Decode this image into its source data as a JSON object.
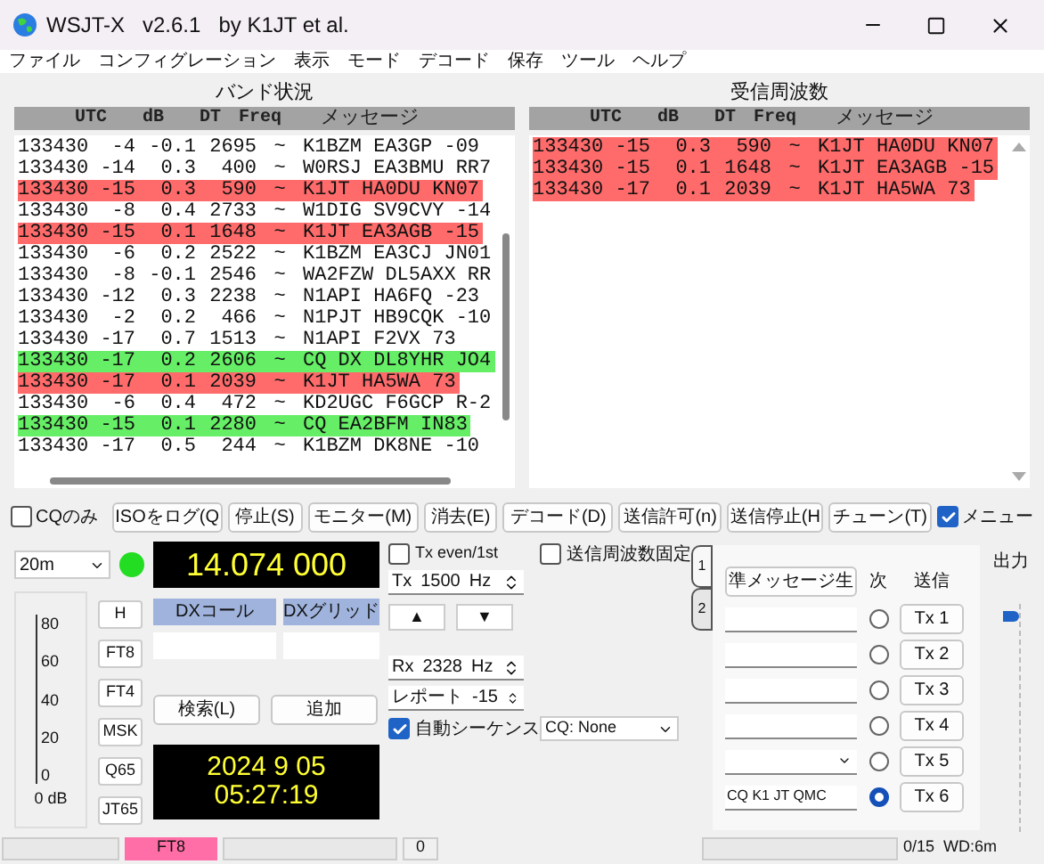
{
  "window": {
    "title": "WSJT-X   v2.6.1   by K1JT et al."
  },
  "menu": [
    "ファイル",
    "コンフィグレーション",
    "表示",
    "モード",
    "デコード",
    "保存",
    "ツール",
    "ヘルプ"
  ],
  "band_activity": {
    "title": "バンド状況",
    "columns": [
      "UTC",
      "dB",
      "DT",
      "Freq",
      "メッセージ"
    ],
    "rows": [
      {
        "utc": "133430",
        "db": "-4",
        "dt": "-0.1",
        "freq": "2695",
        "sep": "~",
        "message": "K1BZM EA3GP -09",
        "color": "#ffffff"
      },
      {
        "utc": "133430",
        "db": "-14",
        "dt": "0.3",
        "freq": "400",
        "sep": "~",
        "message": "W0RSJ EA3BMU RR7",
        "color": "#ffffff"
      },
      {
        "utc": "133430",
        "db": "-15",
        "dt": "0.3",
        "freq": "590",
        "sep": "~",
        "message": "K1JT HA0DU KN07",
        "color": "#ff6b6b"
      },
      {
        "utc": "133430",
        "db": "-8",
        "dt": "0.4",
        "freq": "2733",
        "sep": "~",
        "message": "W1DIG SV9CVY -14",
        "color": "#ffffff"
      },
      {
        "utc": "133430",
        "db": "-15",
        "dt": "0.1",
        "freq": "1648",
        "sep": "~",
        "message": "K1JT EA3AGB -15",
        "color": "#ff6b6b"
      },
      {
        "utc": "133430",
        "db": "-6",
        "dt": "0.2",
        "freq": "2522",
        "sep": "~",
        "message": "K1BZM EA3CJ JN01",
        "color": "#ffffff"
      },
      {
        "utc": "133430",
        "db": "-8",
        "dt": "-0.1",
        "freq": "2546",
        "sep": "~",
        "message": "WA2FZW DL5AXX RR",
        "color": "#ffffff"
      },
      {
        "utc": "133430",
        "db": "-12",
        "dt": "0.3",
        "freq": "2238",
        "sep": "~",
        "message": "N1API HA6FQ -23",
        "color": "#ffffff"
      },
      {
        "utc": "133430",
        "db": "-2",
        "dt": "0.2",
        "freq": "466",
        "sep": "~",
        "message": "N1PJT HB9CQK -10",
        "color": "#ffffff"
      },
      {
        "utc": "133430",
        "db": "-17",
        "dt": "0.7",
        "freq": "1513",
        "sep": "~",
        "message": "N1API F2VX 73",
        "color": "#ffffff"
      },
      {
        "utc": "133430",
        "db": "-17",
        "dt": "0.2",
        "freq": "2606",
        "sep": "~",
        "message": "CQ DX DL8YHR JO4",
        "color": "#66ee66"
      },
      {
        "utc": "133430",
        "db": "-17",
        "dt": "0.1",
        "freq": "2039",
        "sep": "~",
        "message": "K1JT HA5WA 73",
        "color": "#ff6b6b"
      },
      {
        "utc": "133430",
        "db": "-6",
        "dt": "0.4",
        "freq": "472",
        "sep": "~",
        "message": "KD2UGC F6GCP R-2",
        "color": "#ffffff"
      },
      {
        "utc": "133430",
        "db": "-15",
        "dt": "0.1",
        "freq": "2280",
        "sep": "~",
        "message": "CQ EA2BFM IN83",
        "color": "#66ee66"
      },
      {
        "utc": "133430",
        "db": "-17",
        "dt": "0.5",
        "freq": "244",
        "sep": "~",
        "message": "K1BZM DK8NE -10",
        "color": "#ffffff"
      }
    ]
  },
  "rx_frequency": {
    "title": "受信周波数",
    "columns": [
      "UTC",
      "dB",
      "DT",
      "Freq",
      "メッセージ"
    ],
    "rows": [
      {
        "utc": "133430",
        "db": "-15",
        "dt": "0.3",
        "freq": "590",
        "sep": "~",
        "message": "K1JT HA0DU KN07",
        "color": "#ff6b6b"
      },
      {
        "utc": "133430",
        "db": "-15",
        "dt": "0.1",
        "freq": "1648",
        "sep": "~",
        "message": "K1JT EA3AGB -15",
        "color": "#ff6b6b"
      },
      {
        "utc": "133430",
        "db": "-17",
        "dt": "0.1",
        "freq": "2039",
        "sep": "~",
        "message": "K1JT HA5WA 73",
        "color": "#ff6b6b"
      }
    ]
  },
  "cq_only": {
    "label": "CQのみ",
    "checked": false
  },
  "buttons": [
    "ISOをログ(Q",
    "停止(S)",
    "モニター(M)",
    "消去(E)",
    "デコード(D)",
    "送信許可(n)",
    "送信停止(H",
    "チューン(T)"
  ],
  "menus_toggle": {
    "label": "メニュー",
    "checked": true
  },
  "band": {
    "value": "20m"
  },
  "frequency": "14.074 000",
  "meter": {
    "ticks": [
      "80",
      "60",
      "40",
      "20",
      "0"
    ],
    "reading": "0 dB"
  },
  "modes": [
    "H",
    "FT8",
    "FT4",
    "MSK",
    "Q65",
    "JT65"
  ],
  "dx_call": {
    "label": "DXコール"
  },
  "dx_grid": {
    "label": "DXグリッド"
  },
  "lookup_button": "検索(L)",
  "add_button": "追加",
  "clock": {
    "date": "2024 9 05",
    "time": "05:27:19"
  },
  "tx_even": {
    "label": "Tx even/1st",
    "checked": false
  },
  "tx_freq": {
    "prefix": "Tx",
    "value": "1500",
    "unit": "Hz"
  },
  "arrows": [
    "▲",
    "▼"
  ],
  "rx_freq": {
    "prefix": "Rx",
    "value": "2328",
    "unit": "Hz"
  },
  "report": {
    "prefix": "レポート",
    "value": "-15"
  },
  "auto_seq": {
    "label": "自動シーケンス",
    "checked": true
  },
  "hold_tx": {
    "label": "送信周波数固定",
    "checked": false
  },
  "cq_select": {
    "value": "CQ: None"
  },
  "tabs": [
    {
      "label": "1",
      "selected": true
    },
    {
      "label": "2",
      "selected": false
    }
  ],
  "messages": {
    "generate": "準メッセージ生",
    "next_header": "次",
    "send_header": "送信",
    "rows": [
      {
        "kind": "field",
        "value": "",
        "selected": false,
        "button": "Tx 1"
      },
      {
        "kind": "field",
        "value": "",
        "selected": false,
        "button": "Tx 2"
      },
      {
        "kind": "field",
        "value": "",
        "selected": false,
        "button": "Tx 3"
      },
      {
        "kind": "field",
        "value": "",
        "selected": false,
        "button": "Tx 4"
      },
      {
        "kind": "select",
        "value": "",
        "selected": false,
        "button": "Tx 5"
      },
      {
        "kind": "field",
        "value": "CQ K1 JT QMC",
        "selected": true,
        "button": "Tx 6"
      }
    ]
  },
  "power": {
    "label": "出力",
    "level": 0.97
  },
  "status_bar": {
    "mode": "FT8",
    "count": "0",
    "progress": "0/15",
    "wd": "WD:6m"
  }
}
